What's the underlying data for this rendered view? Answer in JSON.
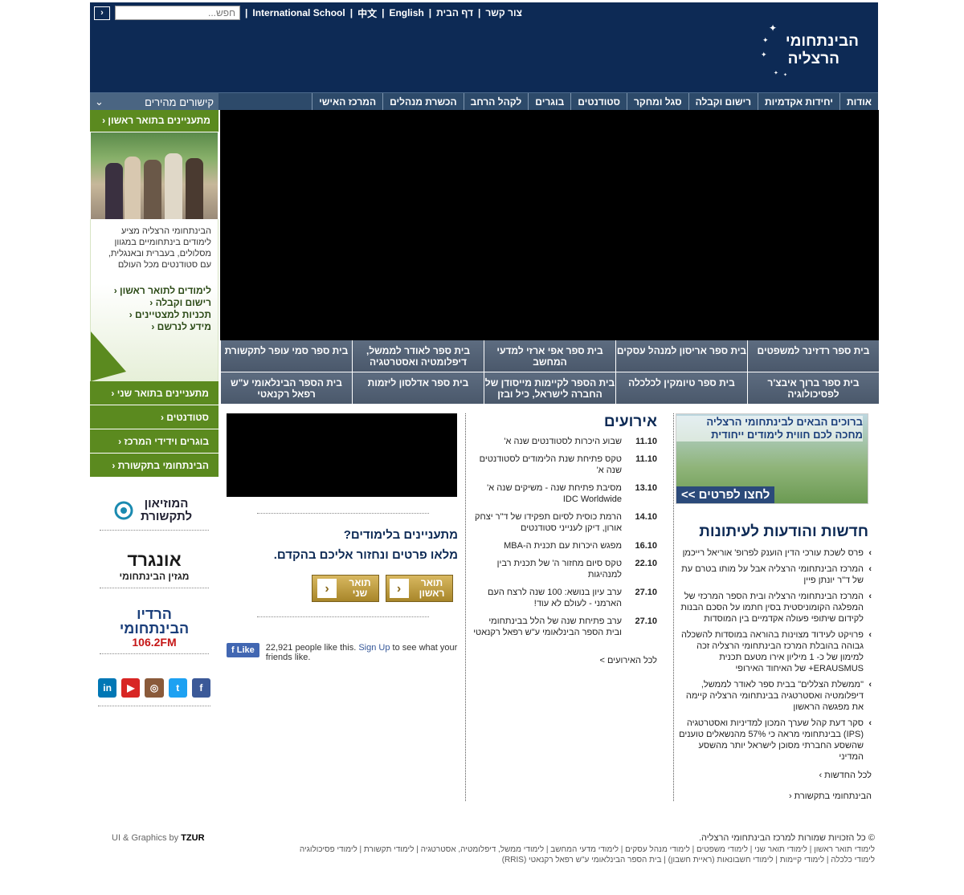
{
  "header": {
    "search_placeholder": "חפש...",
    "go": "›",
    "toplinks": [
      "International School",
      "中文",
      "English",
      "דף הבית",
      "צור קשר"
    ],
    "logo_line1": "הבינתחומי",
    "logo_line2": "הרצליה"
  },
  "nav": {
    "items": [
      "אודות",
      "יחידות אקדמיות",
      "רישום וקבלה",
      "סגל ומחקר",
      "סטודנטים",
      "בוגרים",
      "לקהל הרחב",
      "הכשרת מנהלים",
      "המרכז האישי"
    ],
    "quick": "קישורים מהירים"
  },
  "left": {
    "bachelor_head": "מתעניינים בתואר ראשון ‹",
    "promo_text": "הבינתחומי הרצליה מציע לימודים בינתחומיים במגוון מסלולים, בעברית ובאנגלית, עם סטודנטים מכל העולם",
    "promo_links": [
      "לימודים לתואר ראשון ‹",
      "רישום וקבלה ‹",
      "תכניות למצטיינים ‹",
      "מידע לנרשם ‹"
    ],
    "green_items": [
      "מתעניינים בתואר שני ‹",
      "סטודנטים ‹",
      "בוגרים וידידי המרכז ‹",
      "הבינתחומי בתקשורת ‹"
    ],
    "badge1": "המוזיאון לתקשורת",
    "badge2_a": "אונגרד",
    "badge2_b": "מגזין הבינתחומי",
    "badge3_a": "הרדיו הבינתחומי",
    "badge3_b": "106.2FM",
    "social": [
      "in",
      "▶",
      "◎",
      "t",
      "f"
    ]
  },
  "schools": [
    "בית ספר רדזינר למשפטים",
    "בית ספר אריסון למנהל עסקים",
    "בית ספר אפי ארזי למדעי המחשב",
    "בית ספר לאודר לממשל, דיפלומטיה ואסטרטגיה",
    "בית ספר סמי עופר לתקשורת",
    "בית ספר ברוך איבצ'ר לפסיכולוגיה",
    "בית ספר טיומקין לכלכלה",
    "בית הספר לקיימות מייסודן של החברה לישראל, כיל ובזן",
    "בית ספר אדלסון ליזמות",
    "בית הספר הבינלאומי ע\"ש רפאל רקנאטי"
  ],
  "banner": {
    "title": "ברוכים הבאים לבינתחומי הרצליה מחכה לכם חווית לימודים ייחודית",
    "button": "לחצו לפרטים >>"
  },
  "news": {
    "title": "חדשות והודעות לעיתונות",
    "items": [
      "פרס לשכת עורכי הדין הוענק לפרופ' אוריאל רייכמן",
      "המרכז הבינתחומי הרצליה אבל על מותו בטרם עת של ד\"ר יונתן פיין",
      "המרכז הבינתחומי הרצליה ובית הספר המרכזי של המפלגה הקומוניסטית בסין חתמו על הסכם הבנות לקידום שיתופי פעולה אקדמיים בין המוסדות",
      "פרויקט לעידוד מצוינות בהוראה במוסדות להשכלה גבוהה בהובלת המרכז הבינתחומי הרצליה זכה למימון של כ- 1 מיליון אירו מטעם תכנית ERAUSMUS+ של האיחוד האירופי",
      "\"ממשלת הצללים\" בבית ספר לאודר לממשל, דיפלומטיה ואסטרטגיה בבינתחומי הרצליה קיימה את מפגשה הראשון",
      "סקר דעת קהל שערך המכון למדיניות ואסטרטגיה (IPS) בבינתחומי מראה כי 57% מהנשאלים טוענים שהשסע החברתי מסוכן לישראל יותר מהשסע המדיני"
    ],
    "more": "לכל החדשות ›",
    "media": "הבינתחומי בתקשורת ‹"
  },
  "events": {
    "title": "אירועים",
    "items": [
      {
        "d": "11.10",
        "t": "שבוע היכרות לסטודנטים שנה א'"
      },
      {
        "d": "11.10",
        "t": "טקס פתיחת שנת הלימודים לסטודנטים שנה א'"
      },
      {
        "d": "13.10",
        "t": "מסיבת פתיחת שנה - משיקים שנה א' IDC Worldwide"
      },
      {
        "d": "14.10",
        "t": "הרמת כוסית לסיום תפקידו של ד\"ר יצחק אורון, דיקן לענייני סטודנטים"
      },
      {
        "d": "16.10",
        "t": "מפגש היכרות עם תכנית ה-MBA"
      },
      {
        "d": "22.10",
        "t": "טקס סיום מחזור ה' של תכנית רבין למנהיגות"
      },
      {
        "d": "27.10",
        "t": "ערב עיון בנושא: 100 שנה לרצח העם הארמני - לעולם לא עוד!"
      },
      {
        "d": "27.10",
        "t": "ערב פתיחת שנה של הלל בבינתחומי ובית הספר הבינלאומי ע\"ש רפאל רקנאטי"
      }
    ],
    "more": "לכל האירועים >"
  },
  "cta": {
    "q1": "מתעניינים בלימודים?",
    "q2": "מלאו פרטים ונחזור אליכם בהקדם.",
    "btn1": "תואר ראשון",
    "btn2": "תואר שני",
    "fb_like": "Like",
    "fb_count": "22,921 people like this.",
    "fb_signup": "Sign Up",
    "fb_rest": "to see what your friends like."
  },
  "footer": {
    "credit": "UI & Graphics by",
    "credit_brand": "TZUR",
    "copyright": "© כל הזכויות שמורות למרכז הבינתחומי הרצליה.",
    "links1": "לימודי תואר ראשון | לימודי תואר שני | לימודי משפטים | לימודי מנהל עסקים | לימודי מדעי המחשב | לימודי ממשל, דיפלומטיה, אסטרטגיה | לימודי תקשורת | לימודי פסיכולוגיה",
    "links2": "לימודי כלכלה | לימודי קיימות | לימודי חשבונאות (ראיית חשבון) | בית הספר הבינלאומי ע\"ש רפאל רקנאטי (RRIS)"
  }
}
